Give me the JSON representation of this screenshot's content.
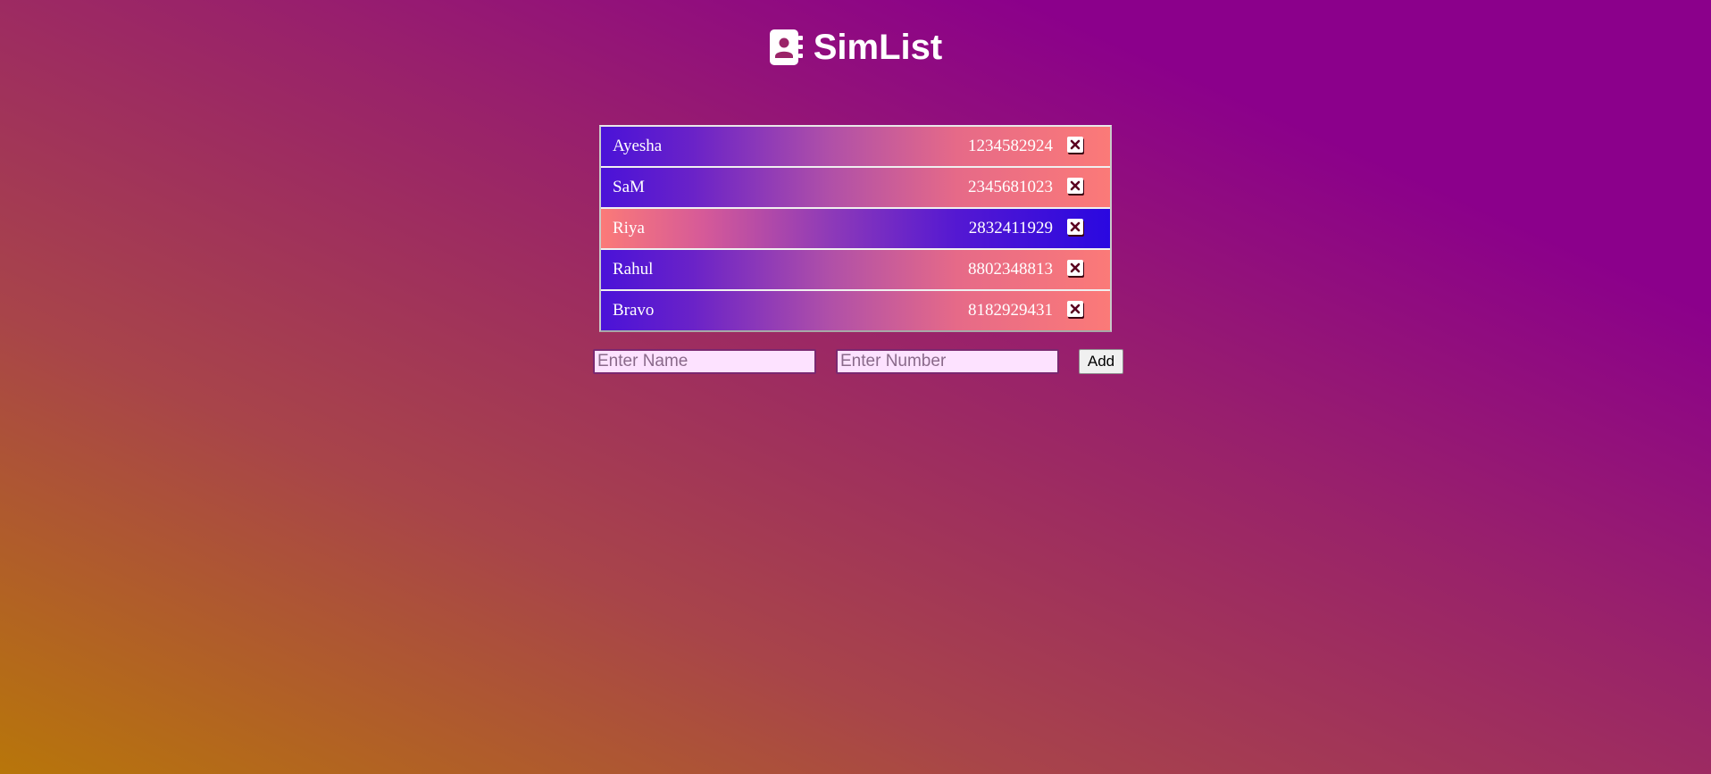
{
  "app": {
    "title": "SimList",
    "logo_icon": "address-book-icon"
  },
  "contacts": [
    {
      "name": "Ayesha",
      "number": "1234582924",
      "delete_icon": "close-box-icon"
    },
    {
      "name": "SaM",
      "number": "2345681023",
      "delete_icon": "close-box-icon"
    },
    {
      "name": "Riya",
      "number": "2832411929",
      "delete_icon": "close-box-icon"
    },
    {
      "name": "Rahul",
      "number": "8802348813",
      "delete_icon": "close-box-icon"
    },
    {
      "name": "Bravo",
      "number": "8182929431",
      "delete_icon": "close-box-icon"
    }
  ],
  "form": {
    "name_placeholder": "Enter Name",
    "number_placeholder": "Enter Number",
    "add_label": "Add"
  },
  "colors": {
    "background_start": "#b8760a",
    "background_end": "#8b008b",
    "row_blue": "#4a12d8",
    "row_coral": "#fb7a78",
    "input_fill": "#fde2ff"
  }
}
